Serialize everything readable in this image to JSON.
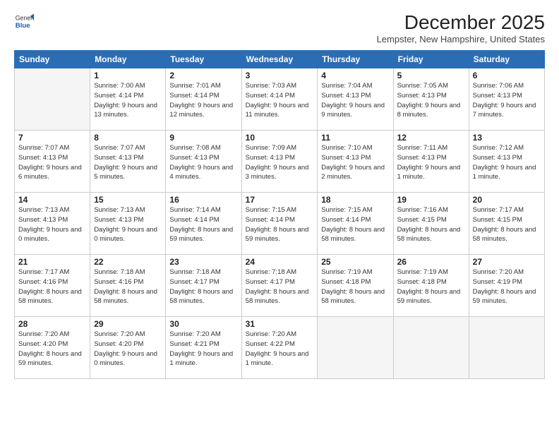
{
  "header": {
    "logo_general": "General",
    "logo_blue": "Blue",
    "title": "December 2025",
    "location": "Lempster, New Hampshire, United States"
  },
  "days_of_week": [
    "Sunday",
    "Monday",
    "Tuesday",
    "Wednesday",
    "Thursday",
    "Friday",
    "Saturday"
  ],
  "weeks": [
    [
      {
        "day": "",
        "info": ""
      },
      {
        "day": "1",
        "info": "Sunrise: 7:00 AM\nSunset: 4:14 PM\nDaylight: 9 hours\nand 13 minutes."
      },
      {
        "day": "2",
        "info": "Sunrise: 7:01 AM\nSunset: 4:14 PM\nDaylight: 9 hours\nand 12 minutes."
      },
      {
        "day": "3",
        "info": "Sunrise: 7:03 AM\nSunset: 4:14 PM\nDaylight: 9 hours\nand 11 minutes."
      },
      {
        "day": "4",
        "info": "Sunrise: 7:04 AM\nSunset: 4:13 PM\nDaylight: 9 hours\nand 9 minutes."
      },
      {
        "day": "5",
        "info": "Sunrise: 7:05 AM\nSunset: 4:13 PM\nDaylight: 9 hours\nand 8 minutes."
      },
      {
        "day": "6",
        "info": "Sunrise: 7:06 AM\nSunset: 4:13 PM\nDaylight: 9 hours\nand 7 minutes."
      }
    ],
    [
      {
        "day": "7",
        "info": "Sunrise: 7:07 AM\nSunset: 4:13 PM\nDaylight: 9 hours\nand 6 minutes."
      },
      {
        "day": "8",
        "info": "Sunrise: 7:07 AM\nSunset: 4:13 PM\nDaylight: 9 hours\nand 5 minutes."
      },
      {
        "day": "9",
        "info": "Sunrise: 7:08 AM\nSunset: 4:13 PM\nDaylight: 9 hours\nand 4 minutes."
      },
      {
        "day": "10",
        "info": "Sunrise: 7:09 AM\nSunset: 4:13 PM\nDaylight: 9 hours\nand 3 minutes."
      },
      {
        "day": "11",
        "info": "Sunrise: 7:10 AM\nSunset: 4:13 PM\nDaylight: 9 hours\nand 2 minutes."
      },
      {
        "day": "12",
        "info": "Sunrise: 7:11 AM\nSunset: 4:13 PM\nDaylight: 9 hours\nand 1 minute."
      },
      {
        "day": "13",
        "info": "Sunrise: 7:12 AM\nSunset: 4:13 PM\nDaylight: 9 hours\nand 1 minute."
      }
    ],
    [
      {
        "day": "14",
        "info": "Sunrise: 7:13 AM\nSunset: 4:13 PM\nDaylight: 9 hours\nand 0 minutes."
      },
      {
        "day": "15",
        "info": "Sunrise: 7:13 AM\nSunset: 4:13 PM\nDaylight: 9 hours\nand 0 minutes."
      },
      {
        "day": "16",
        "info": "Sunrise: 7:14 AM\nSunset: 4:14 PM\nDaylight: 8 hours\nand 59 minutes."
      },
      {
        "day": "17",
        "info": "Sunrise: 7:15 AM\nSunset: 4:14 PM\nDaylight: 8 hours\nand 59 minutes."
      },
      {
        "day": "18",
        "info": "Sunrise: 7:15 AM\nSunset: 4:14 PM\nDaylight: 8 hours\nand 58 minutes."
      },
      {
        "day": "19",
        "info": "Sunrise: 7:16 AM\nSunset: 4:15 PM\nDaylight: 8 hours\nand 58 minutes."
      },
      {
        "day": "20",
        "info": "Sunrise: 7:17 AM\nSunset: 4:15 PM\nDaylight: 8 hours\nand 58 minutes."
      }
    ],
    [
      {
        "day": "21",
        "info": "Sunrise: 7:17 AM\nSunset: 4:16 PM\nDaylight: 8 hours\nand 58 minutes."
      },
      {
        "day": "22",
        "info": "Sunrise: 7:18 AM\nSunset: 4:16 PM\nDaylight: 8 hours\nand 58 minutes."
      },
      {
        "day": "23",
        "info": "Sunrise: 7:18 AM\nSunset: 4:17 PM\nDaylight: 8 hours\nand 58 minutes."
      },
      {
        "day": "24",
        "info": "Sunrise: 7:18 AM\nSunset: 4:17 PM\nDaylight: 8 hours\nand 58 minutes."
      },
      {
        "day": "25",
        "info": "Sunrise: 7:19 AM\nSunset: 4:18 PM\nDaylight: 8 hours\nand 58 minutes."
      },
      {
        "day": "26",
        "info": "Sunrise: 7:19 AM\nSunset: 4:18 PM\nDaylight: 8 hours\nand 59 minutes."
      },
      {
        "day": "27",
        "info": "Sunrise: 7:20 AM\nSunset: 4:19 PM\nDaylight: 8 hours\nand 59 minutes."
      }
    ],
    [
      {
        "day": "28",
        "info": "Sunrise: 7:20 AM\nSunset: 4:20 PM\nDaylight: 8 hours\nand 59 minutes."
      },
      {
        "day": "29",
        "info": "Sunrise: 7:20 AM\nSunset: 4:20 PM\nDaylight: 9 hours\nand 0 minutes."
      },
      {
        "day": "30",
        "info": "Sunrise: 7:20 AM\nSunset: 4:21 PM\nDaylight: 9 hours\nand 1 minute."
      },
      {
        "day": "31",
        "info": "Sunrise: 7:20 AM\nSunset: 4:22 PM\nDaylight: 9 hours\nand 1 minute."
      },
      {
        "day": "",
        "info": ""
      },
      {
        "day": "",
        "info": ""
      },
      {
        "day": "",
        "info": ""
      }
    ]
  ]
}
